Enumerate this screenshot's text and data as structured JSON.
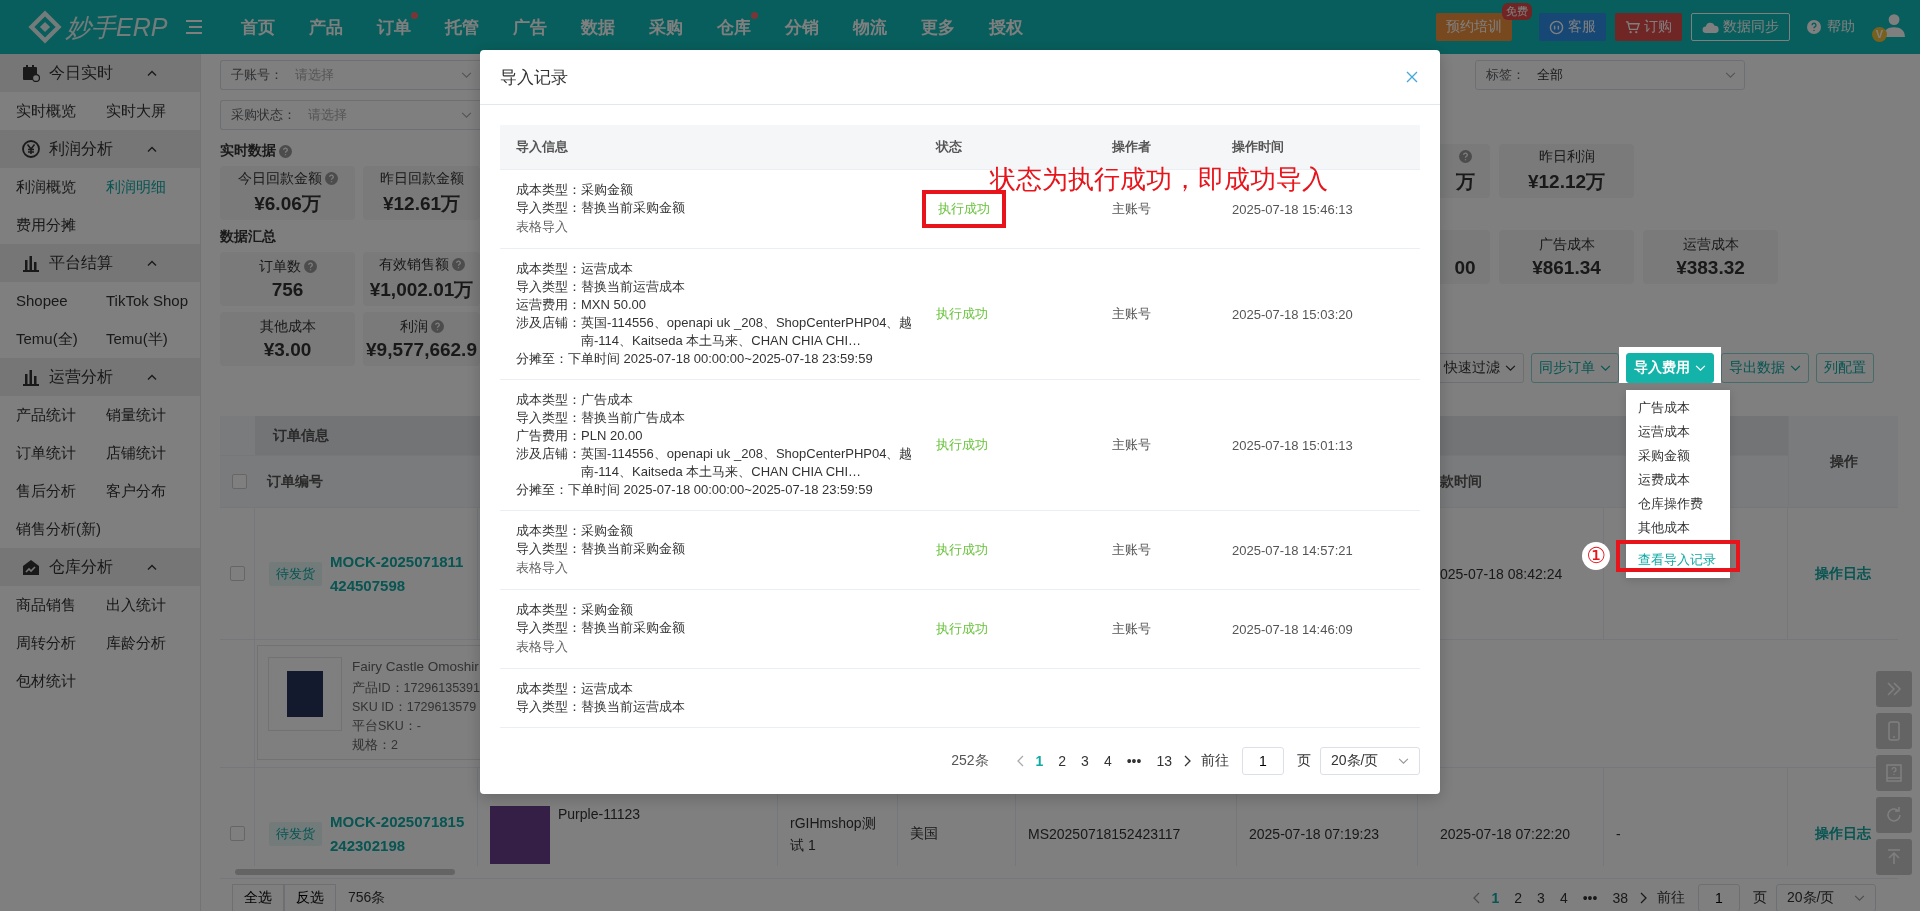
{
  "nav": {
    "logo": "妙手ERP",
    "items": [
      {
        "label": "首页",
        "dot": false
      },
      {
        "label": "产品",
        "dot": false
      },
      {
        "label": "订单",
        "dot": true
      },
      {
        "label": "托管",
        "dot": false
      },
      {
        "label": "广告",
        "dot": false
      },
      {
        "label": "数据",
        "dot": false
      },
      {
        "label": "采购",
        "dot": false
      },
      {
        "label": "仓库",
        "dot": true
      },
      {
        "label": "分销",
        "dot": false
      },
      {
        "label": "物流",
        "dot": false
      },
      {
        "label": "更多",
        "dot": false
      },
      {
        "label": "授权",
        "dot": false
      }
    ],
    "training": {
      "label": "预约培训",
      "badge": "免费"
    },
    "service": "客服",
    "purchase": "订购",
    "sync": "数据同步",
    "help": "帮助",
    "avatar_badge": "V"
  },
  "sidebar": [
    {
      "title": "今日实时",
      "kind": "calendar",
      "expanded": true,
      "items": [
        {
          "label": "实时概览",
          "selected": false
        },
        {
          "label": "实时大屏",
          "selected": false
        }
      ]
    },
    {
      "title": "利润分析",
      "kind": "yen",
      "expanded": true,
      "items": [
        {
          "label": "利润概览",
          "selected": false
        },
        {
          "label": "利润明细",
          "selected": true
        },
        {
          "label": "费用分摊",
          "selected": false
        }
      ]
    },
    {
      "title": "平台结算",
      "kind": "chart",
      "expanded": true,
      "items": [
        {
          "label": "Shopee",
          "selected": false
        },
        {
          "label": "TikTok Shop",
          "selected": false
        },
        {
          "label": "Temu(全)",
          "selected": false
        },
        {
          "label": "Temu(半)",
          "selected": false
        }
      ]
    },
    {
      "title": "运营分析",
      "kind": "chart",
      "expanded": true,
      "items": [
        {
          "label": "产品统计",
          "selected": false
        },
        {
          "label": "销量统计",
          "selected": false
        },
        {
          "label": "订单统计",
          "selected": false
        },
        {
          "label": "店铺统计",
          "selected": false
        },
        {
          "label": "售后分析",
          "selected": false
        },
        {
          "label": "客户分布",
          "selected": false
        },
        {
          "label": "销售分析(新)",
          "selected": false
        }
      ]
    },
    {
      "title": "仓库分析",
      "kind": "warehouse",
      "expanded": true,
      "items": [
        {
          "label": "商品销售",
          "selected": false
        },
        {
          "label": "出入统计",
          "selected": false
        },
        {
          "label": "周转分析",
          "selected": false
        },
        {
          "label": "库龄分析",
          "selected": false
        },
        {
          "label": "包材统计",
          "selected": false
        }
      ]
    }
  ],
  "filters": [
    {
      "label": "子账号：",
      "placeholder": "请选择"
    },
    {
      "label": "采购状态：",
      "placeholder": "请选择"
    }
  ],
  "tag_filter": {
    "label": "标签：",
    "value": "全部"
  },
  "realtime": {
    "title": "实时数据",
    "cards": [
      {
        "label": "今日回款金额",
        "help": true,
        "value": "¥6.06万"
      },
      {
        "label": "昨日回款金额",
        "help": false,
        "value": "¥12.61万"
      }
    ],
    "right_cards": [
      {
        "help": true,
        "value": "万"
      },
      {
        "label": "昨日利润",
        "help": false,
        "value": "¥12.12万"
      }
    ]
  },
  "summary": {
    "title": "数据汇总",
    "cards": [
      {
        "label": "订单数",
        "help": true,
        "value": "756"
      },
      {
        "label": "有效销售额",
        "help": true,
        "value": "¥1,002.01万"
      },
      {
        "label": "其他成本",
        "help": false,
        "value": "¥3.00"
      },
      {
        "label": "利润",
        "help": true,
        "value": "¥9,577,662.9"
      }
    ],
    "right_cards": [
      {
        "value": "00"
      },
      {
        "label": "广告成本",
        "help": false,
        "value": "¥861.34"
      },
      {
        "label": "运营成本",
        "help": false,
        "value": "¥383.32"
      }
    ]
  },
  "toolbar": [
    {
      "label": "快速过滤",
      "kind": "plain",
      "caret": true,
      "open": false
    },
    {
      "label": "同步订单",
      "kind": "outline",
      "caret": true,
      "open": false
    },
    {
      "label": "导入费用",
      "kind": "primary",
      "caret": true,
      "open": true
    },
    {
      "label": "导出数据",
      "kind": "outline",
      "caret": true,
      "open": false
    },
    {
      "label": "列配置",
      "kind": "outline",
      "caret": false,
      "open": false
    }
  ],
  "import_menu": {
    "step": "①",
    "items": [
      {
        "label": "广告成本",
        "selected": false,
        "highlighted": false
      },
      {
        "label": "运营成本",
        "selected": false,
        "highlighted": false
      },
      {
        "label": "采购金额",
        "selected": false,
        "highlighted": false
      },
      {
        "label": "运费成本",
        "selected": false,
        "highlighted": false
      },
      {
        "label": "仓库操作费",
        "selected": false,
        "highlighted": false
      },
      {
        "label": "其他成本",
        "selected": false,
        "highlighted": false
      },
      {
        "label": "查看导入记录",
        "selected": true,
        "highlighted": true
      }
    ]
  },
  "table": {
    "group_header": "订单信息",
    "header_checked": false,
    "order_no_header": "订单编号",
    "column_7_header": "款时间",
    "action_header": "操作",
    "rows": [
      {
        "checked": false,
        "status": "待发货",
        "order_no": "MOCK-2025071811424507598",
        "column_7": "025-07-18 08:42:24",
        "action": "操作日志",
        "product": {
          "title": "Fairy Castle Omoshir",
          "product_id": "产品ID：17296135391",
          "sku_id": "SKU ID：1729613579",
          "platform_sku": "平台SKU：-",
          "spec": "规格：2"
        }
      },
      {
        "checked": false,
        "status": "待发货",
        "order_no": "MOCK-2025071815242302198",
        "product_name": "Purple-11123",
        "shop": "rGIHmshop测试 1",
        "country": "美国",
        "platform_order_no": "MS20250718152423117",
        "column_6": "2025-07-18 07:19:23",
        "column_7": "2025-07-18 07:22:20",
        "column_8": "-",
        "action": "操作日志"
      }
    ]
  },
  "footer": {
    "select_all": "全选",
    "invert": "反选",
    "count": "756条",
    "pagination": {
      "pages": [
        {
          "label": "1",
          "selected": true
        },
        {
          "label": "2",
          "selected": false
        },
        {
          "label": "3",
          "selected": false
        },
        {
          "label": "4",
          "selected": false
        },
        {
          "label": "•••",
          "selected": false
        },
        {
          "label": "38",
          "selected": false
        }
      ],
      "goto": "前往",
      "page_input": "1",
      "page_unit": "页",
      "page_size": "20条/页"
    }
  },
  "modal": {
    "title": "导入记录",
    "annotation": "状态为执行成功，即成功导入",
    "columns": [
      "导入信息",
      "状态",
      "操作者",
      "操作时间"
    ],
    "rows": [
      {
        "info": [
          {
            "label": "成本类型：",
            "value": "采购金额"
          },
          {
            "label": "导入类型：",
            "value": "替换当前采购金额"
          }
        ],
        "note": "表格导入",
        "status": "执行成功",
        "highlighted": true,
        "operator": "主账号",
        "time": "2025-07-18 15:46:13"
      },
      {
        "info": [
          {
            "label": "成本类型：",
            "value": "运营成本"
          },
          {
            "label": "导入类型：",
            "value": "替换当前运营成本"
          },
          {
            "label": "运营费用：",
            "value": "MXN 50.00"
          },
          {
            "label": "涉及店铺：",
            "value": "英国-114556、openapi uk _208、ShopCenterPHP04、越南-114、Kaitseda 本土马来、CHAN CHIA CHI…"
          },
          {
            "label": "分摊至：",
            "value": "下单时间 2025-07-18 00:00:00~2025-07-18 23:59:59"
          }
        ],
        "status": "执行成功",
        "highlighted": false,
        "operator": "主账号",
        "time": "2025-07-18 15:03:20"
      },
      {
        "info": [
          {
            "label": "成本类型：",
            "value": "广告成本"
          },
          {
            "label": "导入类型：",
            "value": "替换当前广告成本"
          },
          {
            "label": "广告费用：",
            "value": "PLN 20.00"
          },
          {
            "label": "涉及店铺：",
            "value": "英国-114556、openapi uk _208、ShopCenterPHP04、越南-114、Kaitseda 本土马来、CHAN CHIA CHI…"
          },
          {
            "label": "分摊至：",
            "value": "下单时间 2025-07-18 00:00:00~2025-07-18 23:59:59"
          }
        ],
        "status": "执行成功",
        "highlighted": false,
        "operator": "主账号",
        "time": "2025-07-18 15:01:13"
      },
      {
        "info": [
          {
            "label": "成本类型：",
            "value": "采购金额"
          },
          {
            "label": "导入类型：",
            "value": "替换当前采购金额"
          }
        ],
        "note": "表格导入",
        "status": "执行成功",
        "highlighted": false,
        "operator": "主账号",
        "time": "2025-07-18 14:57:21"
      },
      {
        "info": [
          {
            "label": "成本类型：",
            "value": "采购金额"
          },
          {
            "label": "导入类型：",
            "value": "替换当前采购金额"
          }
        ],
        "note": "表格导入",
        "status": "执行成功",
        "highlighted": false,
        "operator": "主账号",
        "time": "2025-07-18 14:46:09"
      },
      {
        "info": [
          {
            "label": "成本类型：",
            "value": "运营成本"
          },
          {
            "label": "导入类型：",
            "value": "替换当前运营成本"
          }
        ]
      }
    ],
    "pagination": {
      "total": "252条",
      "pages": [
        {
          "label": "1",
          "selected": true
        },
        {
          "label": "2",
          "selected": false
        },
        {
          "label": "3",
          "selected": false
        },
        {
          "label": "4",
          "selected": false
        },
        {
          "label": "•••",
          "selected": false
        },
        {
          "label": "13",
          "selected": false
        }
      ],
      "goto": "前往",
      "page_input": "1",
      "page_unit": "页",
      "page_size": "20条/页"
    }
  }
}
